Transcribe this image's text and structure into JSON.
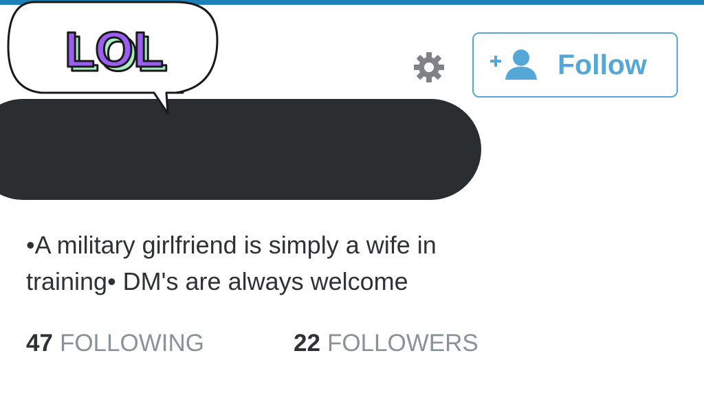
{
  "sticker": {
    "text": "LOL"
  },
  "header": {
    "settings_icon": "gear-icon",
    "follow_icon": "add-user-icon",
    "follow_label": "Follow"
  },
  "profile": {
    "name_redacted": true,
    "bio": [
      "•A military girlfriend is simply a wife in",
      "training• DM's are always welcome"
    ]
  },
  "stats": {
    "following": {
      "count": "47",
      "label": "FOLLOWING"
    },
    "followers": {
      "count": "22",
      "label": "FOLLOWERS"
    }
  },
  "colors": {
    "accent": "#55a7d8",
    "top_bar": "#1c80b8",
    "redaction": "#2a2e31",
    "text": "#2e3135",
    "muted": "#8a9299",
    "sticker_purple": "#9a5ff0",
    "sticker_mint": "#a6ecc6"
  }
}
